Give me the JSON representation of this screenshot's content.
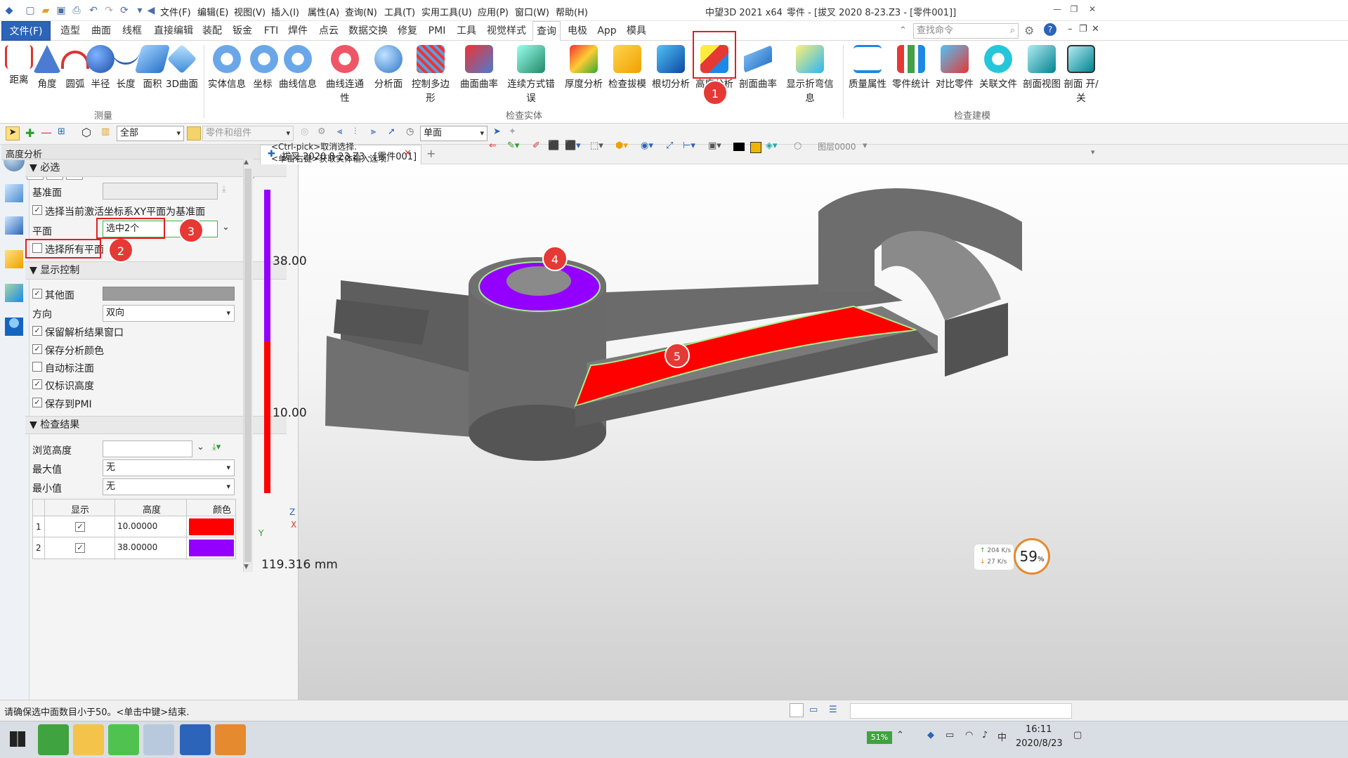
{
  "app": {
    "name": "中望3D 2021 x64",
    "window_title": "零件 - [拔叉  2020  8-23.Z3 - [零件001]]"
  },
  "menubar": [
    "文件(F)",
    "编辑(E)",
    "视图(V)",
    "插入(I)",
    "属性(A)",
    "查询(N)",
    "工具(T)",
    "实用工具(U)",
    "应用(P)",
    "窗口(W)",
    "帮助(H)"
  ],
  "tabs": [
    "文件(F)",
    "造型",
    "曲面",
    "线框",
    "直接编辑",
    "装配",
    "钣金",
    "FTI",
    "焊件",
    "点云",
    "数据交换",
    "修复",
    "PMI",
    "工具",
    "视觉样式",
    "查询",
    "电极",
    "App",
    "模具"
  ],
  "active_tab": "查询",
  "search_placeholder": "查找命令",
  "ribbon": {
    "measure": {
      "label": "测量",
      "items": [
        "距离",
        "角度",
        "圆弧",
        "半径",
        "长度",
        "面积",
        "3D曲面"
      ]
    },
    "check_entity": {
      "label": "检查实体",
      "items": [
        "实体信息",
        "坐标",
        "曲线信息",
        "曲线连通性",
        "分析面",
        "控制多边形",
        "曲面曲率",
        "连续方式错误",
        "厚度分析",
        "检查拔模",
        "根切分析",
        "高度分析",
        "剖面曲率",
        "显示折弯信息"
      ]
    },
    "check_model": {
      "label": "检查建模",
      "items": [
        "质量属性",
        "零件统计",
        "对比零件",
        "关联文件",
        "剖面视图",
        "剖面 开/关"
      ]
    }
  },
  "toolbar2": {
    "filter": "全部",
    "filter2": "零件和组件",
    "face_mode": "单面"
  },
  "panel": {
    "title": "高度分析",
    "required": "必选",
    "base_plane_label": "基准面",
    "use_xy_label": "选择当前激活坐标系XY平面为基准面",
    "plane_label": "平面",
    "plane_value": "选中2个",
    "select_all_label": "选择所有平面",
    "display_control": "显示控制",
    "other_faces_label": "其他面",
    "direction_label": "方向",
    "direction_value": "双向",
    "keep_window_label": "保留解析结果窗口",
    "save_color_label": "保存分析颜色",
    "auto_mark_label": "自动标注面",
    "only_height_label": "仅标识高度",
    "save_pmi_label": "保存到PMI",
    "results": "检查结果",
    "browse_label": "浏览高度",
    "max_label": "最大值",
    "max_value": "无",
    "min_label": "最小值",
    "min_value": "无",
    "table_headers": [
      "显示",
      "高度",
      "颜色"
    ],
    "table_rows": [
      {
        "idx": "1",
        "height": "10.00000",
        "color": "#ff0000"
      },
      {
        "idx": "2",
        "height": "38.00000",
        "color": "#9400ff"
      }
    ]
  },
  "viewport": {
    "doc_tab": "拔叉  2020  8-23.Z3 - [零件001]",
    "hint1": "<Ctrl-pick>取消选择.",
    "hint2": "<单击右键>获取实体输入选项.",
    "legend_high": "38.00",
    "legend_low": "10.00",
    "scale": "119.316 mm",
    "layer": "图层0000",
    "net_up": "204 K/s",
    "net_down": "27 K/s",
    "cpu": "59",
    "cpu_unit": "%"
  },
  "status": "请确保选中面数目小于50。<单击中键>结束.",
  "taskbar": {
    "battery": "51%",
    "time": "16:11",
    "date": "2020/8/23"
  },
  "annotations": [
    "1",
    "2",
    "3",
    "4",
    "5"
  ],
  "colors": {
    "accent": "#2b64b8",
    "red_marker": "#e53935",
    "purple": "#9400ff",
    "red": "#ff0000"
  }
}
